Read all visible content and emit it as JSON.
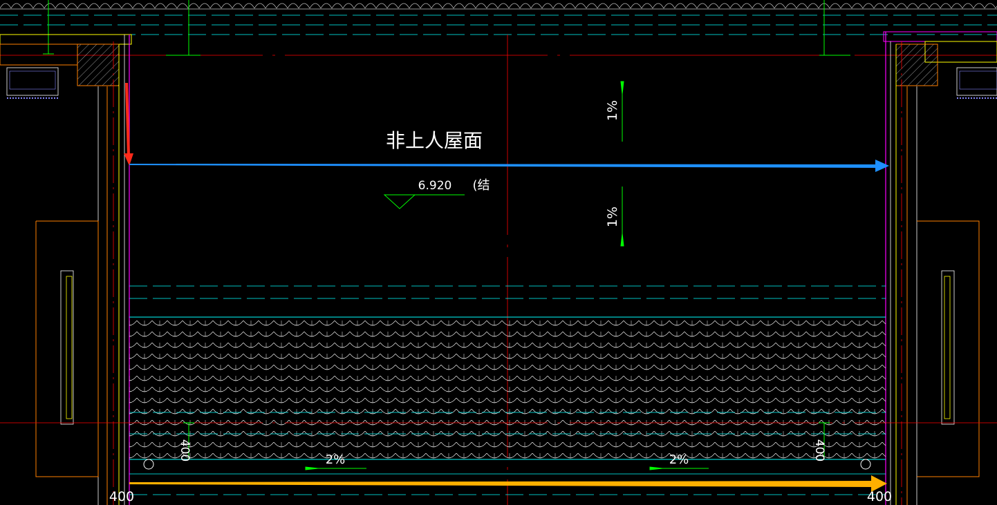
{
  "drawing": {
    "roof_label": "非上人屋面",
    "elevation_value": "6.920",
    "elevation_suffix": "(结",
    "slope_upper": "1%",
    "slope_lower": "1%",
    "slope_left": "2%",
    "slope_right": "2%",
    "dim_left_vertical": "400",
    "dim_right_vertical": "400",
    "dim_left_bottom": "400",
    "dim_right_bottom": "400"
  },
  "colors": {
    "background": "#000000",
    "cyan": "#00ffff",
    "green": "#00ff00",
    "red": "#ff0000",
    "magenta": "#ff00ff",
    "yellow": "#ffff00",
    "orange": "#ff8000",
    "white": "#ffffff",
    "blue_arrow": "#1e90ff",
    "orange_arrow": "#ffb000",
    "red_arrow": "#ff2a1a"
  },
  "icons": {
    "tile_pattern": "roof-tile-pattern",
    "drain": "roof-drain-icon",
    "elevation_marker": "elevation-triangle-icon",
    "slope_arrow": "slope-arrow-icon"
  }
}
